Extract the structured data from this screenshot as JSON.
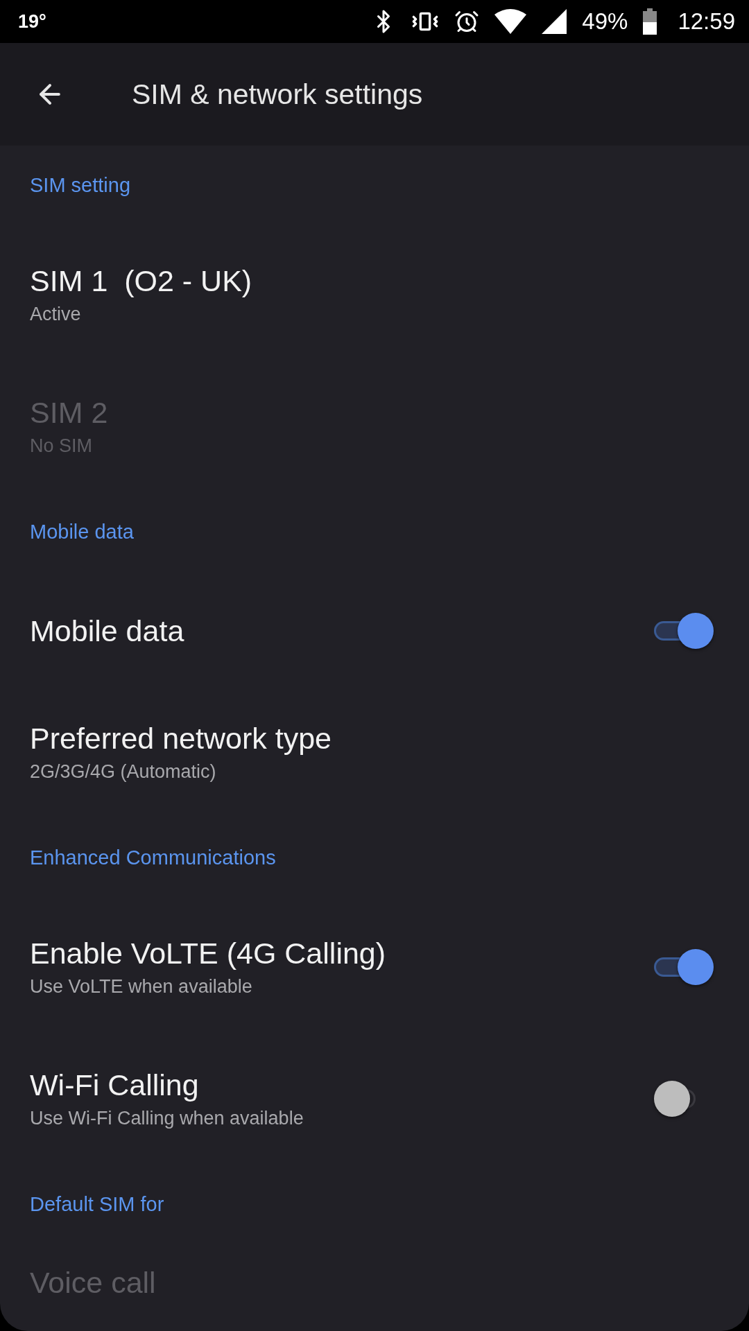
{
  "status_bar": {
    "temperature": "19°",
    "battery": "49%",
    "time": "12:59"
  },
  "app_bar": {
    "title": "SIM & network settings"
  },
  "sections": [
    {
      "header": "SIM setting",
      "items": [
        {
          "kind": "text",
          "title": "SIM 1  (O2 - UK)",
          "subtitle": "Active",
          "disabled": false
        },
        {
          "kind": "text",
          "title": "SIM 2",
          "subtitle": "No SIM",
          "disabled": true
        }
      ]
    },
    {
      "header": "Mobile data",
      "items": [
        {
          "kind": "switch",
          "title": "Mobile data",
          "disabled": false,
          "on": true
        },
        {
          "kind": "text",
          "title": "Preferred network type",
          "subtitle": "2G/3G/4G (Automatic)",
          "disabled": false
        }
      ]
    },
    {
      "header": "Enhanced Communications",
      "items": [
        {
          "kind": "switch",
          "title": "Enable VoLTE (4G Calling)",
          "subtitle": "Use VoLTE when available",
          "disabled": false,
          "on": true
        },
        {
          "kind": "switch",
          "title": "Wi-Fi Calling",
          "subtitle": "Use Wi-Fi Calling when available",
          "disabled": false,
          "on": false
        }
      ]
    },
    {
      "header": "Default SIM for",
      "items": [
        {
          "kind": "text",
          "title": "Voice call",
          "disabled": true
        }
      ]
    }
  ]
}
